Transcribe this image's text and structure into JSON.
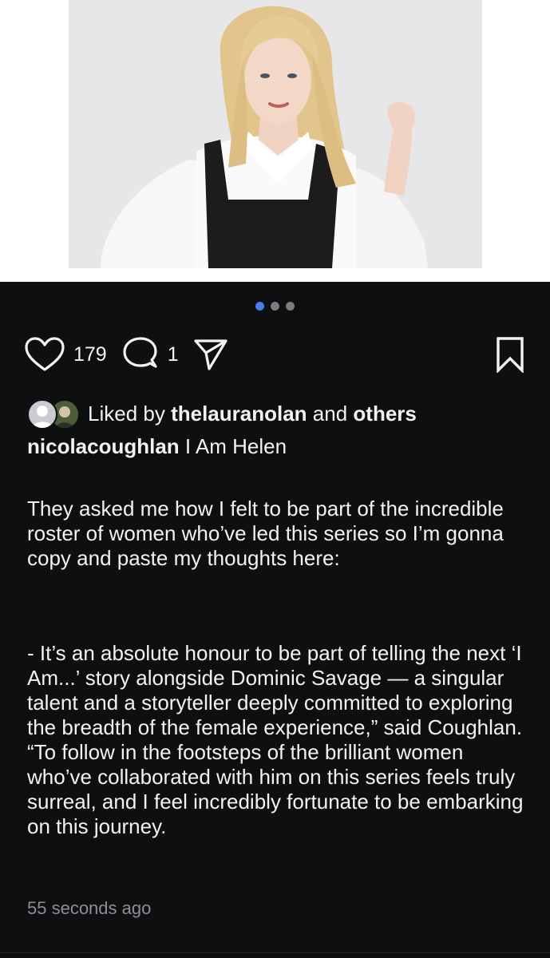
{
  "carousel": {
    "page_count": 3,
    "active_index": 0
  },
  "actions": {
    "like_icon": "heart-icon",
    "like_count": "179",
    "comment_icon": "comment-icon",
    "comment_count": "1",
    "share_icon": "send-icon",
    "save_icon": "bookmark-icon"
  },
  "likes": {
    "prefix": "Liked by",
    "user": "thelauranolan",
    "and": "and",
    "others": "others"
  },
  "caption": {
    "username": "nicolacoughlan",
    "headline": "I Am Helen",
    "paragraph1": "They asked me how I felt to be part of the incredible roster of women who’ve led this series so I’m gonna copy and paste my thoughts here:",
    "paragraph2": "- It’s an absolute honour to be part of telling the next ‘I Am...’ story alongside Dominic Savage — a singular talent and a storyteller deeply committed to exploring the breadth of the female experience,” said Coughlan. “To follow in the footsteps of the brilliant women who’ve collaborated with him on this series feels truly surreal, and I feel incredibly fortunate to be embarking on this journey."
  },
  "timestamp": "55 seconds ago",
  "colors": {
    "background": "#0e0f11",
    "text": "#f2f2f2",
    "muted": "#8c8e93",
    "active_dot": "#4a7cf0",
    "inactive_dot": "#7a7c80"
  }
}
